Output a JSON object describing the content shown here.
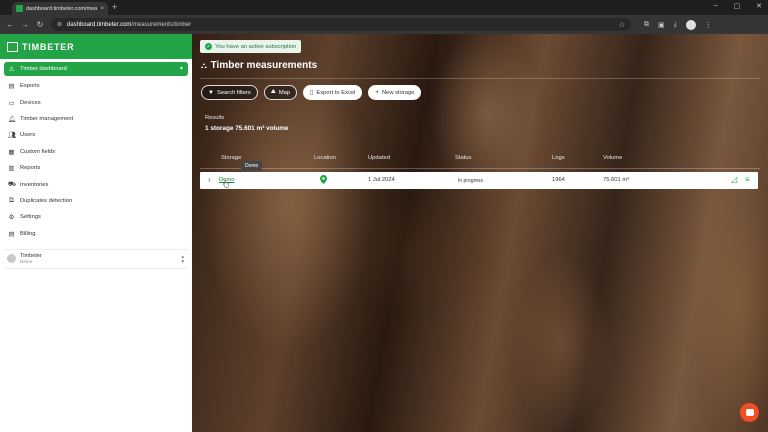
{
  "browser": {
    "tab_title": "dashboard.timbeter.com/mea...",
    "tab_close": "×",
    "new_tab": "+",
    "url_domain": "dashboard.timbeter.com",
    "url_path": "/measurements/timber",
    "window_controls": [
      "–",
      "▢",
      "✕"
    ]
  },
  "sidebar": {
    "brand": "TIMBETER",
    "items": [
      {
        "label": "Timber dashboard",
        "icon": "warning-icon"
      },
      {
        "label": "Exports",
        "icon": "document-icon"
      },
      {
        "label": "Devices",
        "icon": "device-icon"
      },
      {
        "label": "Timber management",
        "icon": "bell-icon"
      },
      {
        "label": "Users",
        "icon": "users-icon"
      },
      {
        "label": "Custom fields",
        "icon": "grid-icon"
      },
      {
        "label": "Reports",
        "icon": "report-icon"
      },
      {
        "label": "Inventories",
        "icon": "truck-icon"
      },
      {
        "label": "Duplicates detection",
        "icon": "copy-icon"
      },
      {
        "label": "Settings",
        "icon": "gear-icon"
      },
      {
        "label": "Billing",
        "icon": "billing-icon"
      }
    ],
    "user": {
      "name": "Timbeter",
      "sub": "Demo"
    }
  },
  "main": {
    "subscription_badge": "You have an active subscription",
    "title": "Timber measurements",
    "actions": {
      "search_filters": "Search filters",
      "map": "Map",
      "export_excel": "Export to Excel",
      "new_storage": "New storage"
    },
    "results_label": "Results",
    "results_value": "1 storage  75.601 m³ volume",
    "table": {
      "headers": {
        "storage": "Storage",
        "location": "Location",
        "updated": "Updated",
        "status": "Status",
        "logs": "Logs",
        "volume": "Volume"
      },
      "rows": [
        {
          "storage": "Demo",
          "updated": "1 Jul 2024",
          "status": "In progress",
          "logs": "1964",
          "volume": "75.601 m³"
        }
      ]
    },
    "tooltip": "Demo"
  },
  "colors": {
    "brand_green": "#22a447",
    "chat_orange": "#f04e23"
  }
}
